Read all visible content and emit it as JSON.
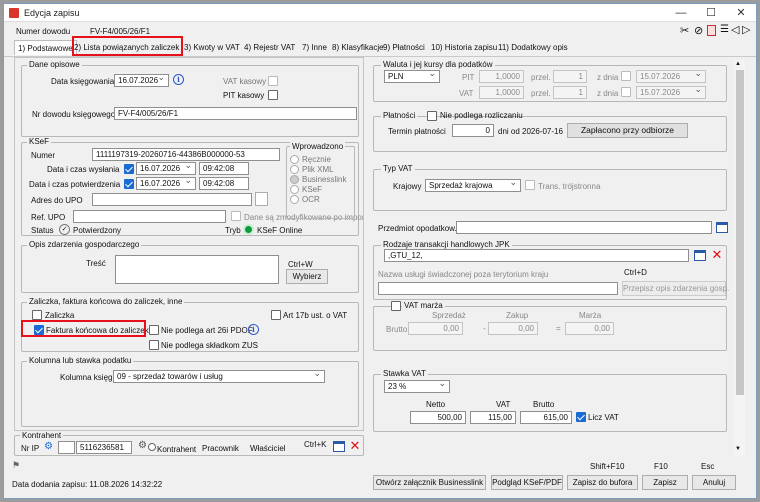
{
  "window": {
    "title": "Edycja zapisu"
  },
  "header": {
    "doc_label": "Numer dowodu",
    "doc_value": "FV-F4/005/26/F1"
  },
  "tabs": [
    "1) Podstawowe",
    "2) Lista powiązanych zaliczek",
    "3) Kwoty w VAT",
    "4) Rejestr VAT",
    "7) Inne",
    "8) Klasyfikacje",
    "9) Płatności",
    "10) Historia zapisu",
    "11) Dodatkowy opis"
  ],
  "dane": {
    "title": "Dane opisowe",
    "data_ksieg_label": "Data księgowania",
    "data_ksieg": "16.07.2026",
    "vat_kasowy": "VAT kasowy",
    "pit_kasowy": "PIT kasowy",
    "nr_dowodu_label": "Nr dowodu księgowego",
    "nr_dowodu": "FV-F4/005/26/F1"
  },
  "ksef": {
    "title": "KSeF",
    "numer_label": "Numer",
    "numer": "1111197319-20260716-44386B000000-53",
    "wyslania_label": "Data i czas wysłania",
    "wyslania_date": "16.07.2026",
    "wyslania_time": "09:42:08",
    "potw_label": "Data i czas potwierdzenia",
    "potw_date": "16.07.2026",
    "potw_time": "09:42:08",
    "adres_label": "Adres do UPO",
    "ref_label": "Ref. UPO",
    "zmod": "Dane są zmodyfikowane po impor.",
    "status_label": "Status",
    "status": "Potwierdzony",
    "tryb_label": "Tryb",
    "tryb": "KSeF Online",
    "wpr_title": "Wprowadzono",
    "wpr": [
      "Ręcznie",
      "Plik XML",
      "Businesslink",
      "KSeF",
      "OCR"
    ]
  },
  "opis": {
    "title": "Opis zdarzenia gospodarczego",
    "tresc_label": "Treść",
    "shortcut": "Ctrl+W",
    "wybierz": "Wybierz"
  },
  "zal": {
    "title": "Zaliczka, faktura końcowa do zaliczek, inne",
    "zaliczka": "Zaliczka",
    "art17": "Art 17b ust. o VAT",
    "faktura": "Faktura końcowa do zaliczek",
    "nie26": "Nie podlega art 26i PDOF",
    "niezus": "Nie podlega składkom ZUS"
  },
  "kolumna": {
    "title": "Kolumna lub stawka podatku",
    "label": "Kolumna księgi",
    "value": "09 - sprzedaż towarów i usług"
  },
  "kontrahent": {
    "title": "Kontrahent",
    "nip_label": "Nr IP",
    "nip": "5116236581",
    "tabs": [
      "Kontrahent",
      "Pracownik",
      "Właściciel"
    ],
    "shortcut": "Ctrl+K"
  },
  "waluta": {
    "title": "Waluta i jej kursy dla podatków",
    "currency": "PLN",
    "pit_label": "PIT",
    "vat_label": "VAT",
    "kurs": "1,0000",
    "przel_label": "przel.",
    "przel": "1",
    "zdnia_label": "z dnia",
    "date": "15.07.2026"
  },
  "platnosci": {
    "title": "Płatności",
    "nie_label": "Nie podlega rozliczaniu",
    "termin_label": "Termin płatności",
    "termin_days": "0",
    "dni_od": "dni od 2026-07-16",
    "zaplacono": "Zapłacono przy odbiorze"
  },
  "typvat": {
    "title": "Typ VAT",
    "krajowy_label": "Krajowy",
    "krajowy": "Sprzedaż krajowa",
    "trans": "Trans. trójstronna"
  },
  "przedmiot_label": "Przedmiot opodatkow.",
  "jpk": {
    "title": "Rodzaje transakcji handlowych JPK",
    "value": ",GTU_12,",
    "nazwa_label": "Nazwa usługi świadczonej poza terytorium kraju",
    "shortcut": "Ctrl+D",
    "przepisz": "Przepisz opis zdarzenia gosp."
  },
  "vatmarza": {
    "title": "VAT marża",
    "brutto_label": "Brutto",
    "sprzedaz_label": "Sprzedaż",
    "zakup_label": "Zakup",
    "marza_label": "Marża",
    "sprzedaz": "0,00",
    "zakup": "0,00",
    "marza": "0,00",
    "minus": "-",
    "eq": "="
  },
  "stawka": {
    "title": "Stawka VAT",
    "value": "23 %",
    "netto_label": "Netto",
    "vat_label": "VAT",
    "brutto_label": "Brutto",
    "netto": "500,00",
    "vat": "115,00",
    "brutto": "615,00",
    "licz": "Licz VAT"
  },
  "footer": {
    "date_label": "Data dodania zapisu: 11.08.2026 14:32:22",
    "btn_bl": "Otwórz załącznik Businesslink",
    "btn_podglad": "Podgląd KSeF/PDF",
    "btn_bufor": "Zapisz do bufora",
    "btn_zapisz": "Zapisz",
    "btn_anuluj": "Anuluj",
    "sc_bufor": "Shift+F10",
    "sc_zapisz": "F10",
    "sc_anuluj": "Esc"
  },
  "colors": {
    "accent": "#1a6bd3",
    "highlight": "#e8111b",
    "ksef_green": "#0f9a3b"
  }
}
